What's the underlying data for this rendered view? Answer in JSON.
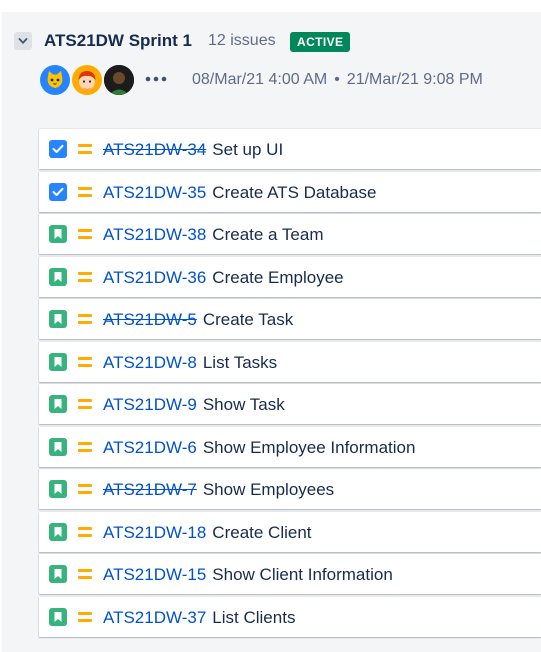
{
  "sprint": {
    "name": "ATS21DW Sprint 1",
    "issue_count": "12 issues",
    "status": "ACTIVE",
    "start_date": "08/Mar/21 4:00 AM",
    "separator": "•",
    "end_date": "21/Mar/21 9:08 PM",
    "avatars": [
      "cat-avatar",
      "redhead-avatar",
      "photo-avatar"
    ],
    "colors": {
      "status_badge": "#00875a",
      "link": "#0052cc",
      "task": "#2684ff",
      "story": "#36b37e",
      "priority_medium": "#ffab00"
    }
  },
  "issues": [
    {
      "type": "task",
      "done": true,
      "key": "ATS21DW-34",
      "summary": "Set up UI"
    },
    {
      "type": "task",
      "done": false,
      "key": "ATS21DW-35",
      "summary": "Create ATS Database"
    },
    {
      "type": "story",
      "done": false,
      "key": "ATS21DW-38",
      "summary": "Create a Team"
    },
    {
      "type": "story",
      "done": false,
      "key": "ATS21DW-36",
      "summary": "Create Employee"
    },
    {
      "type": "story",
      "done": true,
      "key": "ATS21DW-5",
      "summary": "Create Task"
    },
    {
      "type": "story",
      "done": false,
      "key": "ATS21DW-8",
      "summary": "List Tasks"
    },
    {
      "type": "story",
      "done": false,
      "key": "ATS21DW-9",
      "summary": "Show Task"
    },
    {
      "type": "story",
      "done": false,
      "key": "ATS21DW-6",
      "summary": "Show Employee Information"
    },
    {
      "type": "story",
      "done": true,
      "key": "ATS21DW-7",
      "summary": "Show Employees"
    },
    {
      "type": "story",
      "done": false,
      "key": "ATS21DW-18",
      "summary": "Create Client"
    },
    {
      "type": "story",
      "done": false,
      "key": "ATS21DW-15",
      "summary": "Show Client Information"
    },
    {
      "type": "story",
      "done": false,
      "key": "ATS21DW-37",
      "summary": "List Clients"
    }
  ]
}
